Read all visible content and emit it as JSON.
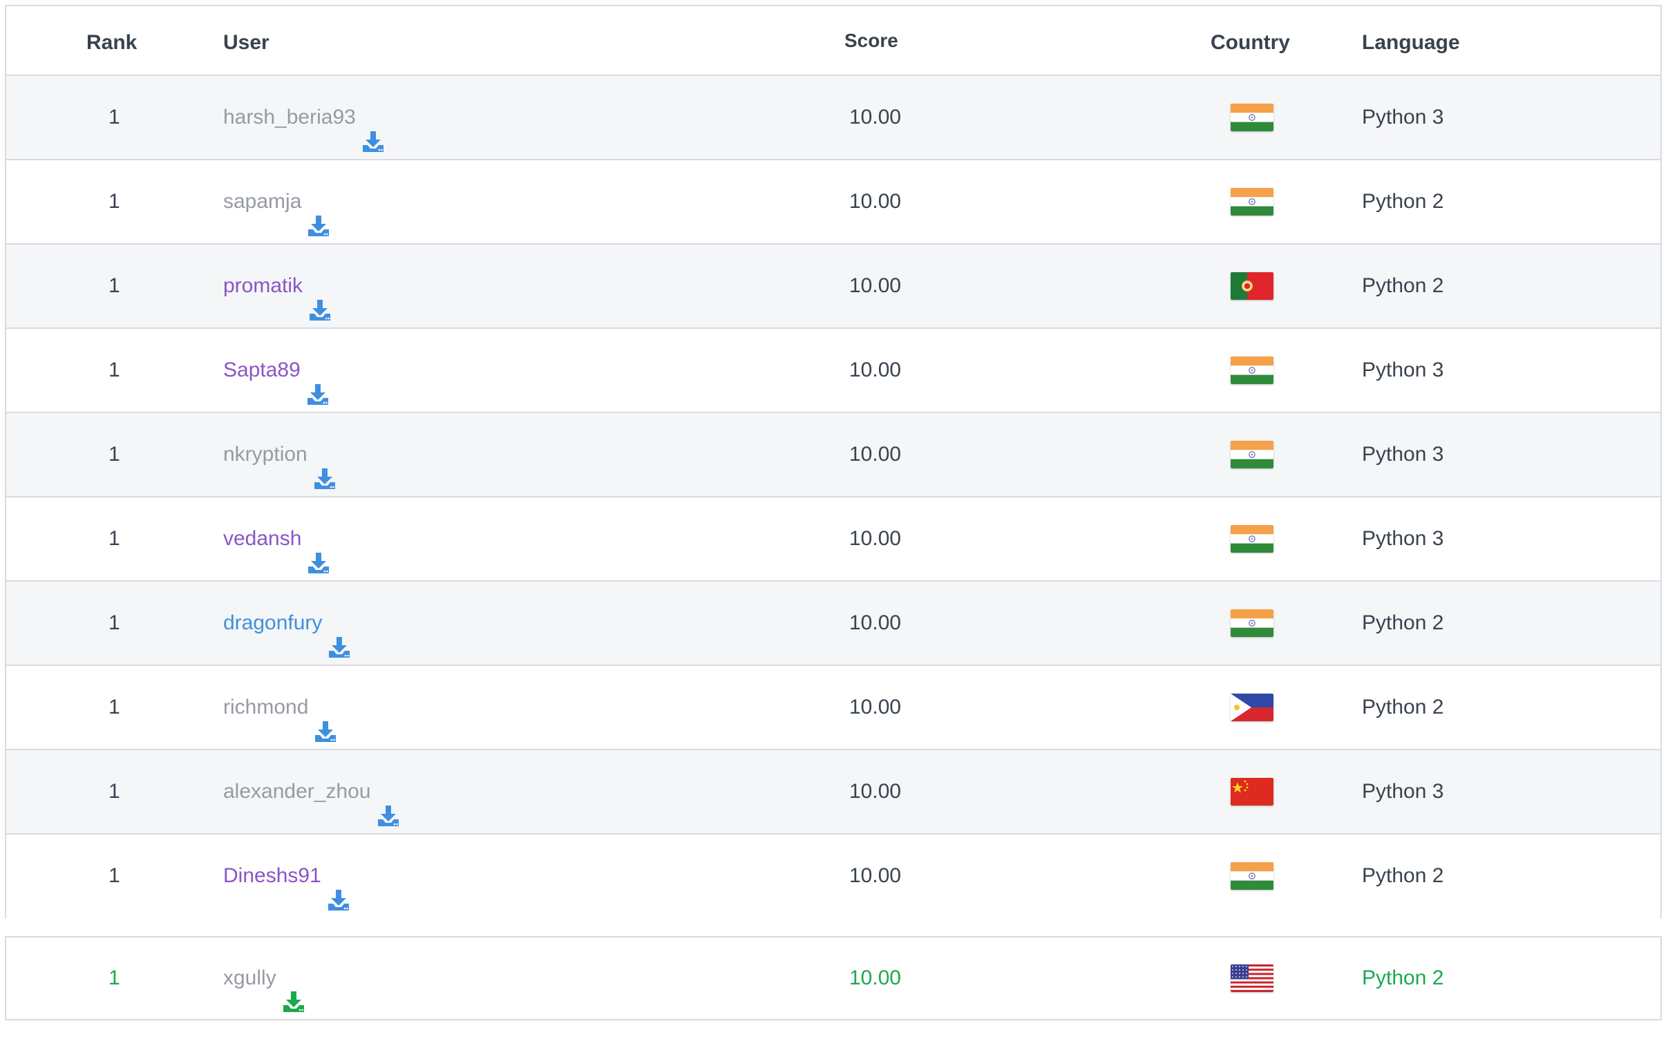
{
  "header": {
    "rank": "Rank",
    "user": "User",
    "score": "Score",
    "country": "Country",
    "language": "Language"
  },
  "rows": [
    {
      "rank": "1",
      "user": "harsh_beria93",
      "user_color": "gray",
      "score": "10.00",
      "country_flag": "india-flag",
      "language": "Python 3"
    },
    {
      "rank": "1",
      "user": "sapamja",
      "user_color": "gray",
      "score": "10.00",
      "country_flag": "india-flag",
      "language": "Python 2"
    },
    {
      "rank": "1",
      "user": "promatik",
      "user_color": "purple",
      "score": "10.00",
      "country_flag": "portugal-flag",
      "language": "Python 2"
    },
    {
      "rank": "1",
      "user": "Sapta89",
      "user_color": "purple",
      "score": "10.00",
      "country_flag": "india-flag",
      "language": "Python 3"
    },
    {
      "rank": "1",
      "user": "nkryption",
      "user_color": "gray",
      "score": "10.00",
      "country_flag": "india-flag",
      "language": "Python 3"
    },
    {
      "rank": "1",
      "user": "vedansh",
      "user_color": "purple",
      "score": "10.00",
      "country_flag": "india-flag",
      "language": "Python 3"
    },
    {
      "rank": "1",
      "user": "dragonfury",
      "user_color": "blue",
      "score": "10.00",
      "country_flag": "india-flag",
      "language": "Python 2"
    },
    {
      "rank": "1",
      "user": "richmond",
      "user_color": "gray",
      "score": "10.00",
      "country_flag": "philippines-flag",
      "language": "Python 2"
    },
    {
      "rank": "1",
      "user": "alexander_zhou",
      "user_color": "gray",
      "score": "10.00",
      "country_flag": "china-flag",
      "language": "Python 3"
    },
    {
      "rank": "1",
      "user": "Dineshs91",
      "user_color": "purple",
      "score": "10.00",
      "country_flag": "india-flag",
      "language": "Python 2"
    }
  ],
  "current_user": {
    "rank": "1",
    "user": "xgully",
    "score": "10.00",
    "country_flag": "usa-flag",
    "language": "Python 2"
  },
  "colors": {
    "header_text": "#39424e",
    "body_text": "#39424e",
    "user_gray": "#959aa3",
    "user_purple": "#8a55c7",
    "user_blue": "#3f8fe0",
    "download_icon_blue": "#3f8fe0",
    "current_user_green": "#1ba94c",
    "row_alt": "#f5f6f8",
    "border": "#d8dbe0"
  },
  "icons": {
    "download": "download-icon"
  }
}
